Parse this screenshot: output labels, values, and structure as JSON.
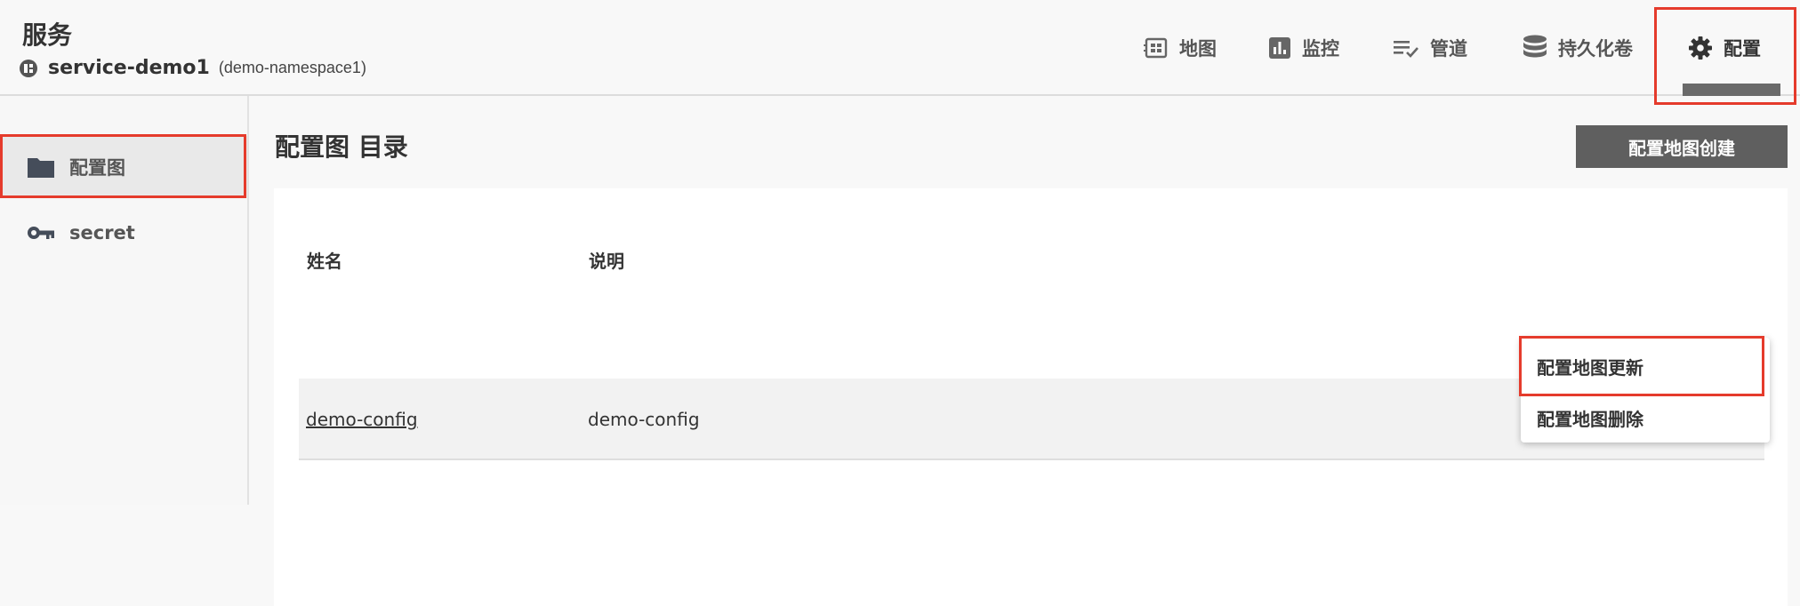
{
  "header": {
    "app_title": "服务",
    "service_name": "service-demo1",
    "namespace": "(demo-namespace1)"
  },
  "nav": {
    "map": "地图",
    "monitor": "监控",
    "pipeline": "管道",
    "volume": "持久化卷",
    "config": "配置"
  },
  "sidebar": {
    "items": [
      {
        "label": "配置图"
      },
      {
        "label": "secret"
      }
    ]
  },
  "main": {
    "title": "配置图 目录",
    "create_button": "配置地图创建",
    "table": {
      "columns": [
        "姓名",
        "说明"
      ],
      "rows": [
        {
          "name": "demo-config",
          "description": "demo-config"
        }
      ]
    }
  },
  "context_menu": {
    "items": [
      "配置地图更新",
      "配置地图删除"
    ]
  },
  "colors": {
    "highlight": "#e53b2c",
    "button_bg": "#5f5f5f"
  }
}
